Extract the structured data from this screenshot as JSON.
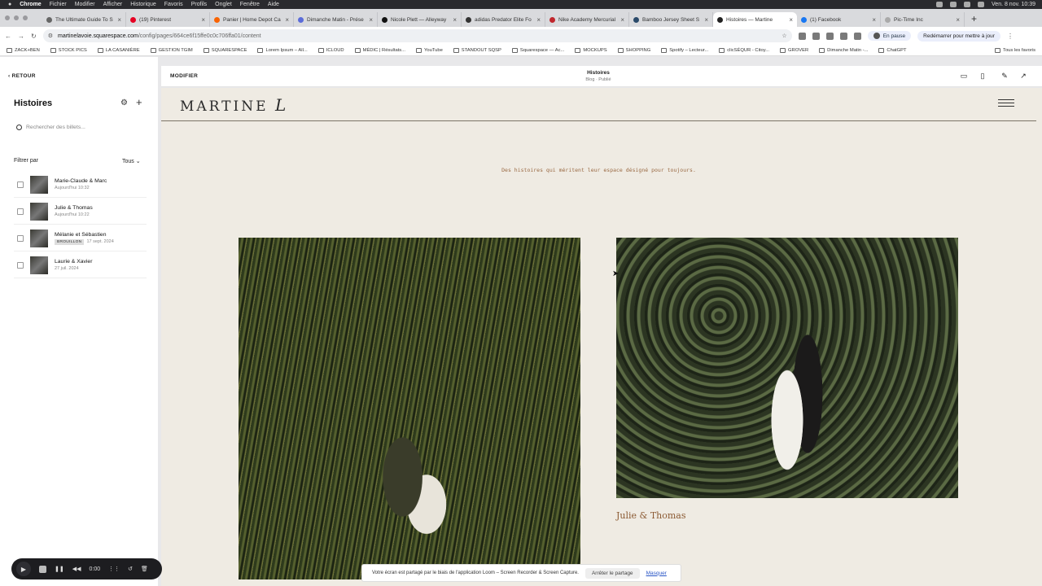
{
  "menubar": {
    "app": "Chrome",
    "items": [
      "Fichier",
      "Modifier",
      "Afficher",
      "Historique",
      "Favoris",
      "Profils",
      "Onglet",
      "Fenêtre",
      "Aide"
    ],
    "clock": "Ven. 8 nov. 10:39"
  },
  "tabs": [
    {
      "title": "The Ultimate Guide To S",
      "color": "#666"
    },
    {
      "title": "(19) Pinterest",
      "color": "#e60023"
    },
    {
      "title": "Panier | Home Depot Ca",
      "color": "#f96302"
    },
    {
      "title": "Dimanche Matin - Prése",
      "color": "#5b6cd9"
    },
    {
      "title": "Nicole Plett — Alleyway",
      "color": "#111"
    },
    {
      "title": "adidas Predator Elite Fo",
      "color": "#333"
    },
    {
      "title": "Nike Academy Mercurial",
      "color": "#c0272d"
    },
    {
      "title": "Bamboo Jersey Sheet S",
      "color": "#2a4a6a"
    },
    {
      "title": "Histoires — Martine",
      "color": "#222",
      "active": true
    },
    {
      "title": "(1) Facebook",
      "color": "#1877f2"
    },
    {
      "title": "Pic-Time Inc",
      "color": "#aaa"
    }
  ],
  "address": {
    "domain": "martinelavoie.squarespace.com",
    "path": "/config/pages/664ce6f15ffe0c0c706ffa01/content"
  },
  "toolbar": {
    "paused": "En pause",
    "restart": "Redémarrer pour mettre à jour"
  },
  "bookmarks": [
    "ZACK+BEN",
    "STOCK PICS",
    "LA CASANIÈRE",
    "GESTION TGIM",
    "SQUARESPACE",
    "Lorem Ipsum – All...",
    "ICLOUD",
    "MÉDIC | Résultats...",
    "YouTube",
    "STANDOUT SQSP",
    "Squarespace — Ac...",
    "MOCKUPS",
    "SHOPPING",
    "Spotify – Lecteur...",
    "clicSÉQUR - Citoy...",
    "GROVER",
    "Dimanche Matin -...",
    "ChatGPT"
  ],
  "bookmarks_all": "Tous les favoris",
  "sidebar": {
    "back": "RETOUR",
    "title": "Histoires",
    "search_placeholder": "Rechercher des billets...",
    "filter_label": "Filtrer par",
    "filter_value": "Tous",
    "posts": [
      {
        "name": "Marie-Claude & Marc",
        "date": "Aujourd'hui 10:32",
        "badge": ""
      },
      {
        "name": "Julie & Thomas",
        "date": "Aujourd'hui 10:22",
        "badge": ""
      },
      {
        "name": "Mélanie et Sébastien",
        "date": "17 sept. 2024",
        "badge": "BROUILLON"
      },
      {
        "name": "Laurie & Xavier",
        "date": "27 juil. 2024",
        "badge": ""
      }
    ]
  },
  "editor": {
    "modify": "MODIFIER",
    "page_title": "Histoires",
    "page_sub": "Blog · Publié"
  },
  "site": {
    "logo_text": "MARTINE",
    "logo_mark": "L",
    "tagline": "Des histoires qui méritent leur espace désigné pour toujours.",
    "caption2": "Julie & Thomas"
  },
  "loom": {
    "time": "0:00"
  },
  "share": {
    "message": "Votre écran est partagé par le biais de l'application Loom – Screen Recorder & Screen Capture.",
    "stop": "Arrêter le partage",
    "hide": "Masquer"
  }
}
